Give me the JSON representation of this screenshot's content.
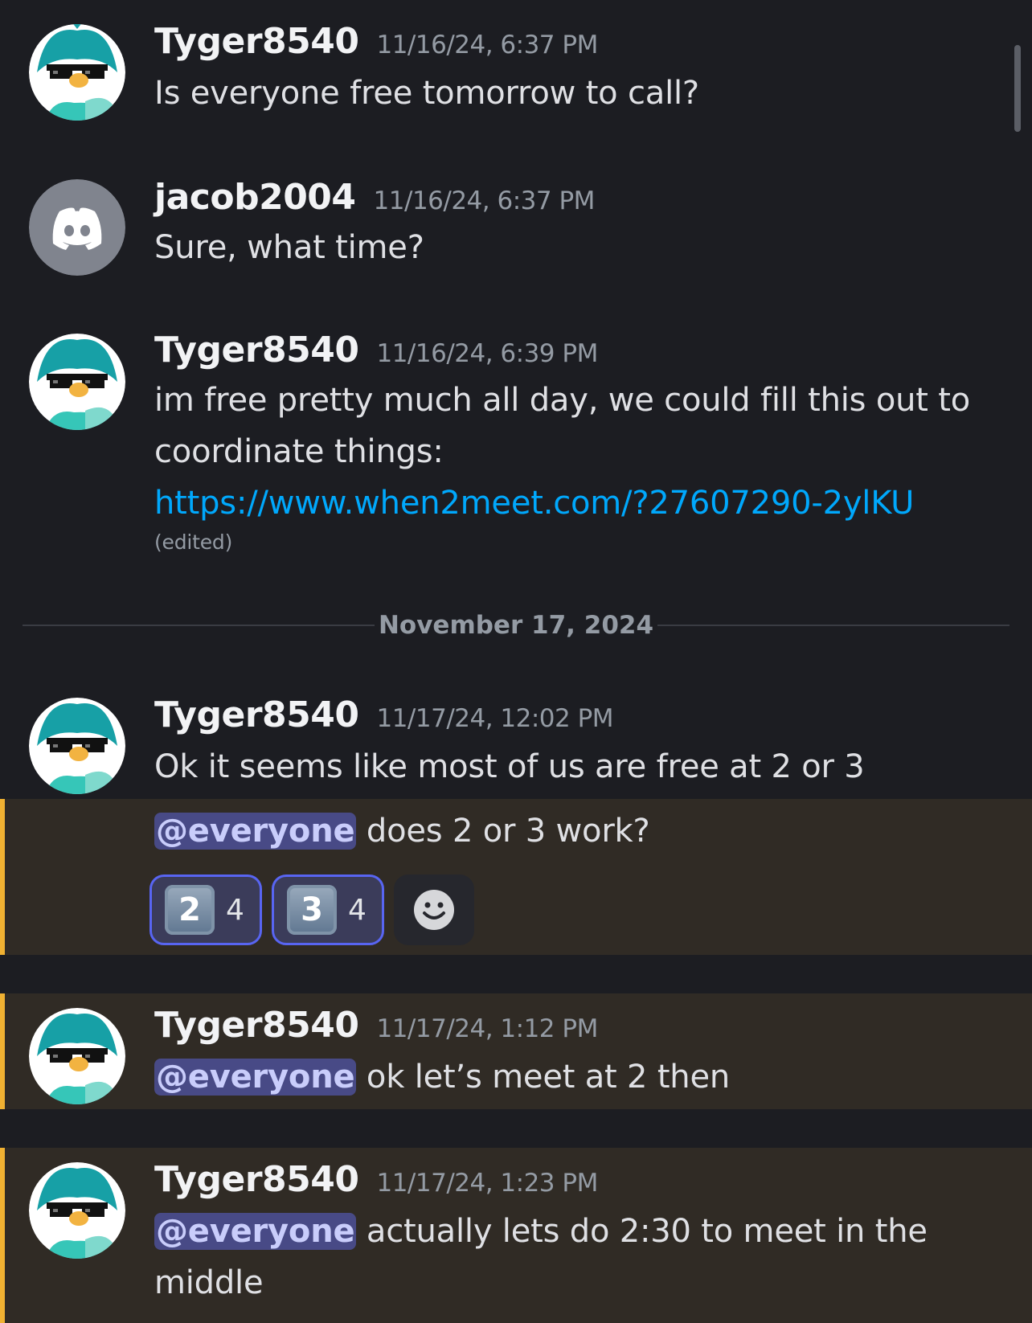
{
  "messages": [
    {
      "username": "Tyger8540",
      "timestamp": "11/16/24, 6:37 PM",
      "text": "Is everyone free tomorrow to call?"
    },
    {
      "username": "jacob2004",
      "timestamp": "11/16/24, 6:37 PM",
      "text": "Sure, what time?"
    },
    {
      "username": "Tyger8540",
      "timestamp": "11/16/24, 6:39 PM",
      "text": "im free pretty much all day, we could fill this out to coordinate things:",
      "link": "https://www.when2meet.com/?27607290-2ylKU",
      "edited": "(edited)"
    },
    {
      "username": "Tyger8540",
      "timestamp": "11/17/24, 12:02 PM",
      "text": "Ok it seems like most of us are free at 2 or 3"
    },
    {
      "mention": "@everyone",
      "text": " does 2 or 3 work?",
      "reactions": [
        {
          "emoji": "2",
          "count": "4"
        },
        {
          "emoji": "3",
          "count": "4"
        }
      ]
    },
    {
      "username": "Tyger8540",
      "timestamp": "11/17/24, 1:12 PM",
      "mention": "@everyone",
      "text": " ok let’s meet at 2 then"
    },
    {
      "username": "Tyger8540",
      "timestamp": "11/17/24, 1:23 PM",
      "mention": "@everyone",
      "text": " actually lets do 2:30 to meet in the middle"
    }
  ],
  "date_divider": "November 17, 2024",
  "colors": {
    "background": "#1c1d22",
    "highlight": "#302b25",
    "highlight_bar": "#f0b132",
    "link": "#00a8fc",
    "mention_bg": "#484a86",
    "reaction_border": "#5865f2"
  },
  "icons": {
    "discord_avatar": "discord-logo-icon",
    "add_reaction": "smiley-icon"
  }
}
